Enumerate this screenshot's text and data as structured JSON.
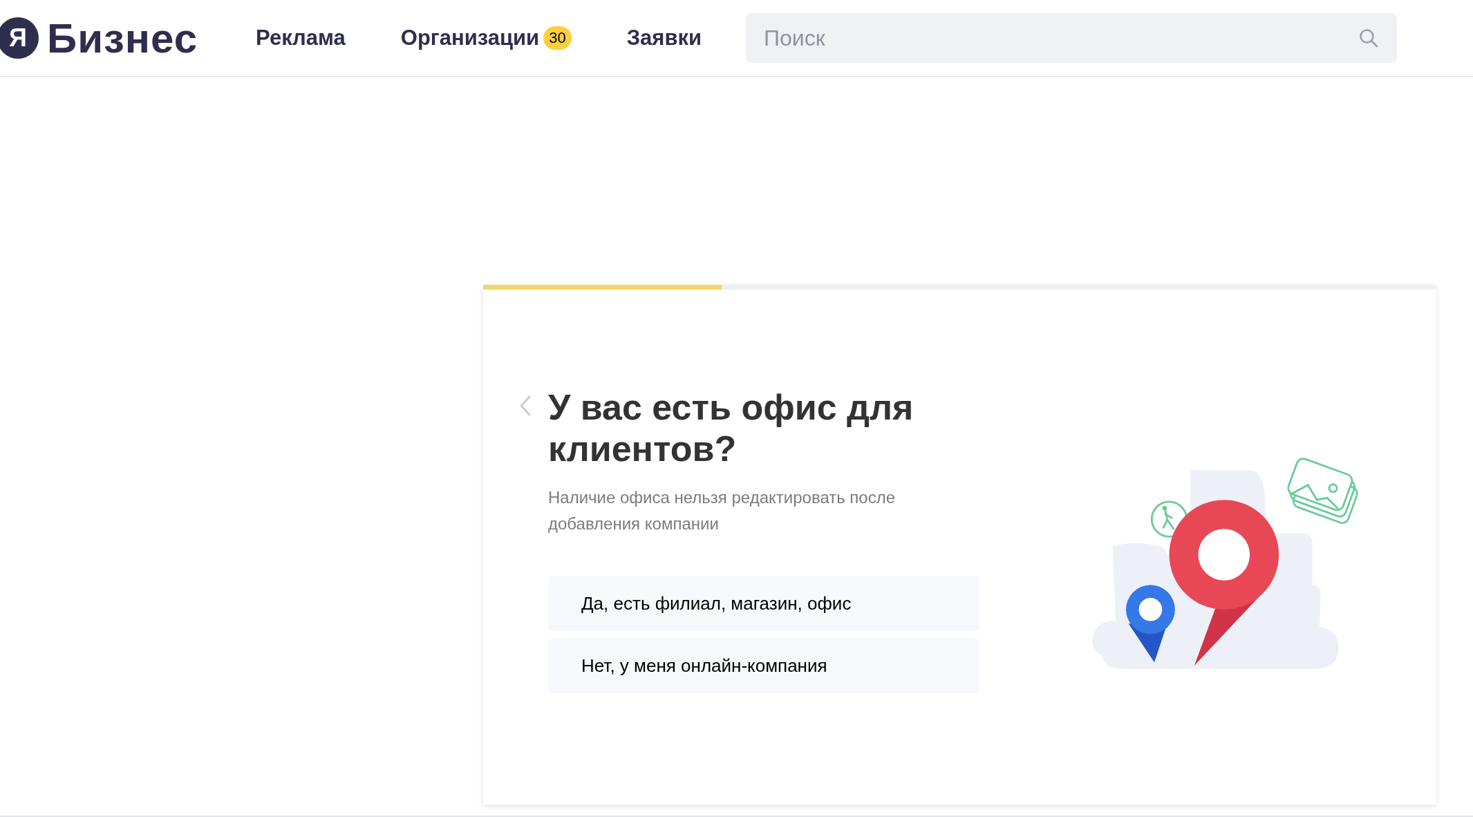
{
  "header": {
    "logo": {
      "letter": "Я",
      "name": "Бизнес"
    },
    "nav": [
      {
        "label": "Реклама"
      },
      {
        "label": "Организации",
        "badge": "30"
      },
      {
        "label": "Заявки"
      }
    ],
    "search": {
      "placeholder": "Поиск"
    }
  },
  "wizard": {
    "progress": {
      "level": 0.25
    },
    "title": "У вас есть офис для клиентов?",
    "subtitle": "Наличие офиса нельзя редактировать после добавления компании",
    "options": [
      {
        "label": "Да, есть филиал, магазин, офис"
      },
      {
        "label": "Нет, у меня онлайн-компания"
      }
    ]
  }
}
